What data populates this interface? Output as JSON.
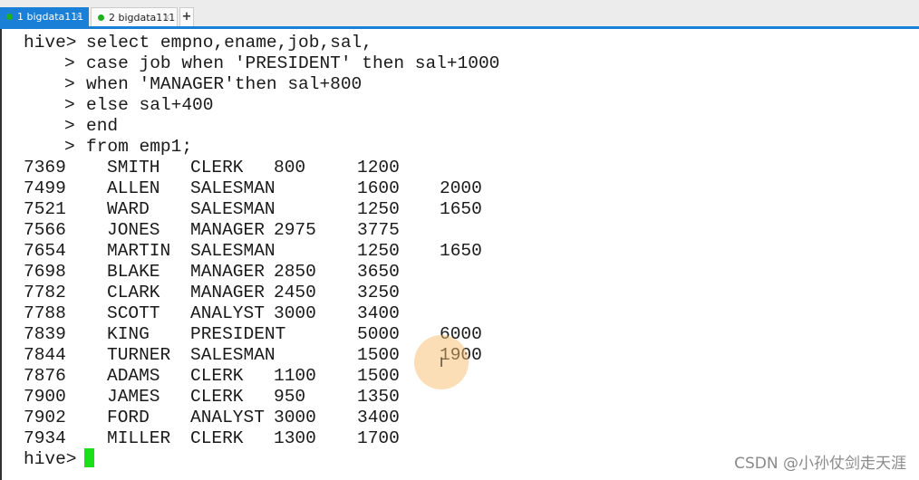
{
  "tabs": [
    {
      "label": "1 bigdata111",
      "active": true,
      "status_color": "#1fb01f"
    },
    {
      "label": "2 bigdata111",
      "active": false,
      "status_color": "#1fb01f"
    }
  ],
  "tab_close": "×",
  "add_tab": "+",
  "prompt": "hive>",
  "continuation": ">",
  "query_lines": [
    "select empno,ename,job,sal,",
    "case job when 'PRESIDENT' then sal+1000",
    "when 'MANAGER'then sal+800",
    "else sal+400",
    "end",
    "from emp1;"
  ],
  "rows": [
    [
      "7369",
      "SMITH",
      "CLERK",
      "800",
      "1200",
      ""
    ],
    [
      "7499",
      "ALLEN",
      "SALESMAN",
      "",
      "1600",
      "2000"
    ],
    [
      "7521",
      "WARD",
      "SALESMAN",
      "",
      "1250",
      "1650"
    ],
    [
      "7566",
      "JONES",
      "MANAGER",
      "2975",
      "3775",
      ""
    ],
    [
      "7654",
      "MARTIN",
      "SALESMAN",
      "",
      "1250",
      "1650"
    ],
    [
      "7698",
      "BLAKE",
      "MANAGER",
      "2850",
      "3650",
      ""
    ],
    [
      "7782",
      "CLARK",
      "MANAGER",
      "2450",
      "3250",
      ""
    ],
    [
      "7788",
      "SCOTT",
      "ANALYST",
      "3000",
      "3400",
      ""
    ],
    [
      "7839",
      "KING",
      "PRESIDENT",
      "",
      "5000",
      "6000"
    ],
    [
      "7844",
      "TURNER",
      "SALESMAN",
      "",
      "1500",
      "1900"
    ],
    [
      "7876",
      "ADAMS",
      "CLERK",
      "1100",
      "1500",
      ""
    ],
    [
      "7900",
      "JAMES",
      "CLERK",
      "950",
      "1350",
      ""
    ],
    [
      "7902",
      "FORD",
      "ANALYST",
      "3000",
      "3400",
      ""
    ],
    [
      "7934",
      "MILLER",
      "CLERK",
      "1300",
      "1700",
      ""
    ]
  ],
  "cursor_color": "#19e019",
  "watermark": "CSDN @小孙仗剑走天涯"
}
